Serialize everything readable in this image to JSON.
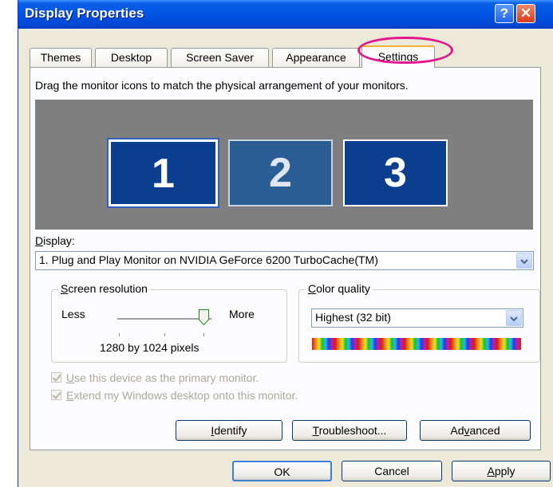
{
  "window": {
    "title": "Display Properties"
  },
  "titlebar": {
    "help_label": "?",
    "close_label": "✕"
  },
  "tabs": [
    {
      "label": "Themes"
    },
    {
      "label": "Desktop"
    },
    {
      "label": "Screen Saver"
    },
    {
      "label": "Appearance"
    },
    {
      "label": "Settings",
      "active": true
    }
  ],
  "settings": {
    "instruction": "Drag the monitor icons to match the physical arrangement of your monitors.",
    "monitors": [
      {
        "number": "1",
        "selected": true
      },
      {
        "number": "2",
        "selected": false
      },
      {
        "number": "3",
        "selected": false
      }
    ],
    "display_label": {
      "accel": "D",
      "rest": "isplay:"
    },
    "display_value": "1. Plug and Play Monitor on NVIDIA GeForce 6200 TurboCache(TM)",
    "resolution": {
      "group_title": {
        "accel": "S",
        "rest": "creen resolution"
      },
      "less_label": "Less",
      "more_label": "More",
      "value_text": "1280 by 1024 pixels",
      "slider_position": 1.0
    },
    "color_quality": {
      "group_title": {
        "accel": "C",
        "rest": "olor quality"
      },
      "selected": "Highest (32 bit)"
    },
    "checkboxes": [
      {
        "accel": "U",
        "rest": "se this device as the primary monitor.",
        "checked": true,
        "disabled": true
      },
      {
        "accel": "E",
        "rest": "xtend my Windows desktop onto this monitor.",
        "checked": true,
        "disabled": true
      }
    ],
    "buttons": {
      "identify": {
        "accel": "I",
        "rest": "dentify"
      },
      "troubleshoot": {
        "accel": "T",
        "rest": "roubleshoot..."
      },
      "advanced": {
        "pre": "Ad",
        "accel": "v",
        "rest": "anced"
      }
    }
  },
  "footer": {
    "ok": "OK",
    "cancel": "Cancel",
    "apply": {
      "accel": "A",
      "rest": "pply"
    }
  },
  "colors": {
    "titlebar": "#0055e5",
    "dialog_bg": "#ece9d8",
    "highlight_ring": "#e3158f",
    "monitor_blue": "#0b3e8f"
  }
}
